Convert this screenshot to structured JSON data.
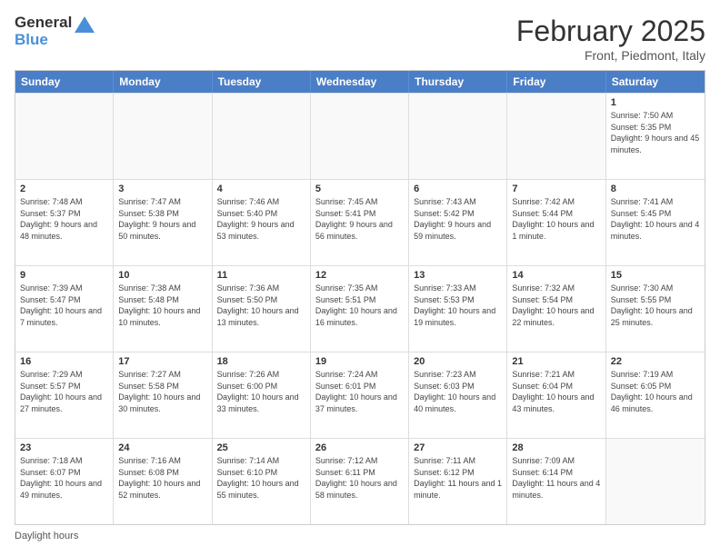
{
  "header": {
    "logo_general": "General",
    "logo_blue": "Blue",
    "month_title": "February 2025",
    "subtitle": "Front, Piedmont, Italy"
  },
  "days_of_week": [
    "Sunday",
    "Monday",
    "Tuesday",
    "Wednesday",
    "Thursday",
    "Friday",
    "Saturday"
  ],
  "weeks": [
    {
      "days": [
        {
          "num": "",
          "info": "",
          "empty": true
        },
        {
          "num": "",
          "info": "",
          "empty": true
        },
        {
          "num": "",
          "info": "",
          "empty": true
        },
        {
          "num": "",
          "info": "",
          "empty": true
        },
        {
          "num": "",
          "info": "",
          "empty": true
        },
        {
          "num": "",
          "info": "",
          "empty": true
        },
        {
          "num": "1",
          "info": "Sunrise: 7:50 AM\nSunset: 5:35 PM\nDaylight: 9 hours and 45 minutes.",
          "empty": false
        }
      ]
    },
    {
      "days": [
        {
          "num": "2",
          "info": "Sunrise: 7:48 AM\nSunset: 5:37 PM\nDaylight: 9 hours and 48 minutes.",
          "empty": false
        },
        {
          "num": "3",
          "info": "Sunrise: 7:47 AM\nSunset: 5:38 PM\nDaylight: 9 hours and 50 minutes.",
          "empty": false
        },
        {
          "num": "4",
          "info": "Sunrise: 7:46 AM\nSunset: 5:40 PM\nDaylight: 9 hours and 53 minutes.",
          "empty": false
        },
        {
          "num": "5",
          "info": "Sunrise: 7:45 AM\nSunset: 5:41 PM\nDaylight: 9 hours and 56 minutes.",
          "empty": false
        },
        {
          "num": "6",
          "info": "Sunrise: 7:43 AM\nSunset: 5:42 PM\nDaylight: 9 hours and 59 minutes.",
          "empty": false
        },
        {
          "num": "7",
          "info": "Sunrise: 7:42 AM\nSunset: 5:44 PM\nDaylight: 10 hours and 1 minute.",
          "empty": false
        },
        {
          "num": "8",
          "info": "Sunrise: 7:41 AM\nSunset: 5:45 PM\nDaylight: 10 hours and 4 minutes.",
          "empty": false
        }
      ]
    },
    {
      "days": [
        {
          "num": "9",
          "info": "Sunrise: 7:39 AM\nSunset: 5:47 PM\nDaylight: 10 hours and 7 minutes.",
          "empty": false
        },
        {
          "num": "10",
          "info": "Sunrise: 7:38 AM\nSunset: 5:48 PM\nDaylight: 10 hours and 10 minutes.",
          "empty": false
        },
        {
          "num": "11",
          "info": "Sunrise: 7:36 AM\nSunset: 5:50 PM\nDaylight: 10 hours and 13 minutes.",
          "empty": false
        },
        {
          "num": "12",
          "info": "Sunrise: 7:35 AM\nSunset: 5:51 PM\nDaylight: 10 hours and 16 minutes.",
          "empty": false
        },
        {
          "num": "13",
          "info": "Sunrise: 7:33 AM\nSunset: 5:53 PM\nDaylight: 10 hours and 19 minutes.",
          "empty": false
        },
        {
          "num": "14",
          "info": "Sunrise: 7:32 AM\nSunset: 5:54 PM\nDaylight: 10 hours and 22 minutes.",
          "empty": false
        },
        {
          "num": "15",
          "info": "Sunrise: 7:30 AM\nSunset: 5:55 PM\nDaylight: 10 hours and 25 minutes.",
          "empty": false
        }
      ]
    },
    {
      "days": [
        {
          "num": "16",
          "info": "Sunrise: 7:29 AM\nSunset: 5:57 PM\nDaylight: 10 hours and 27 minutes.",
          "empty": false
        },
        {
          "num": "17",
          "info": "Sunrise: 7:27 AM\nSunset: 5:58 PM\nDaylight: 10 hours and 30 minutes.",
          "empty": false
        },
        {
          "num": "18",
          "info": "Sunrise: 7:26 AM\nSunset: 6:00 PM\nDaylight: 10 hours and 33 minutes.",
          "empty": false
        },
        {
          "num": "19",
          "info": "Sunrise: 7:24 AM\nSunset: 6:01 PM\nDaylight: 10 hours and 37 minutes.",
          "empty": false
        },
        {
          "num": "20",
          "info": "Sunrise: 7:23 AM\nSunset: 6:03 PM\nDaylight: 10 hours and 40 minutes.",
          "empty": false
        },
        {
          "num": "21",
          "info": "Sunrise: 7:21 AM\nSunset: 6:04 PM\nDaylight: 10 hours and 43 minutes.",
          "empty": false
        },
        {
          "num": "22",
          "info": "Sunrise: 7:19 AM\nSunset: 6:05 PM\nDaylight: 10 hours and 46 minutes.",
          "empty": false
        }
      ]
    },
    {
      "days": [
        {
          "num": "23",
          "info": "Sunrise: 7:18 AM\nSunset: 6:07 PM\nDaylight: 10 hours and 49 minutes.",
          "empty": false
        },
        {
          "num": "24",
          "info": "Sunrise: 7:16 AM\nSunset: 6:08 PM\nDaylight: 10 hours and 52 minutes.",
          "empty": false
        },
        {
          "num": "25",
          "info": "Sunrise: 7:14 AM\nSunset: 6:10 PM\nDaylight: 10 hours and 55 minutes.",
          "empty": false
        },
        {
          "num": "26",
          "info": "Sunrise: 7:12 AM\nSunset: 6:11 PM\nDaylight: 10 hours and 58 minutes.",
          "empty": false
        },
        {
          "num": "27",
          "info": "Sunrise: 7:11 AM\nSunset: 6:12 PM\nDaylight: 11 hours and 1 minute.",
          "empty": false
        },
        {
          "num": "28",
          "info": "Sunrise: 7:09 AM\nSunset: 6:14 PM\nDaylight: 11 hours and 4 minutes.",
          "empty": false
        },
        {
          "num": "",
          "info": "",
          "empty": true
        }
      ]
    }
  ],
  "footer": {
    "daylight_label": "Daylight hours"
  }
}
